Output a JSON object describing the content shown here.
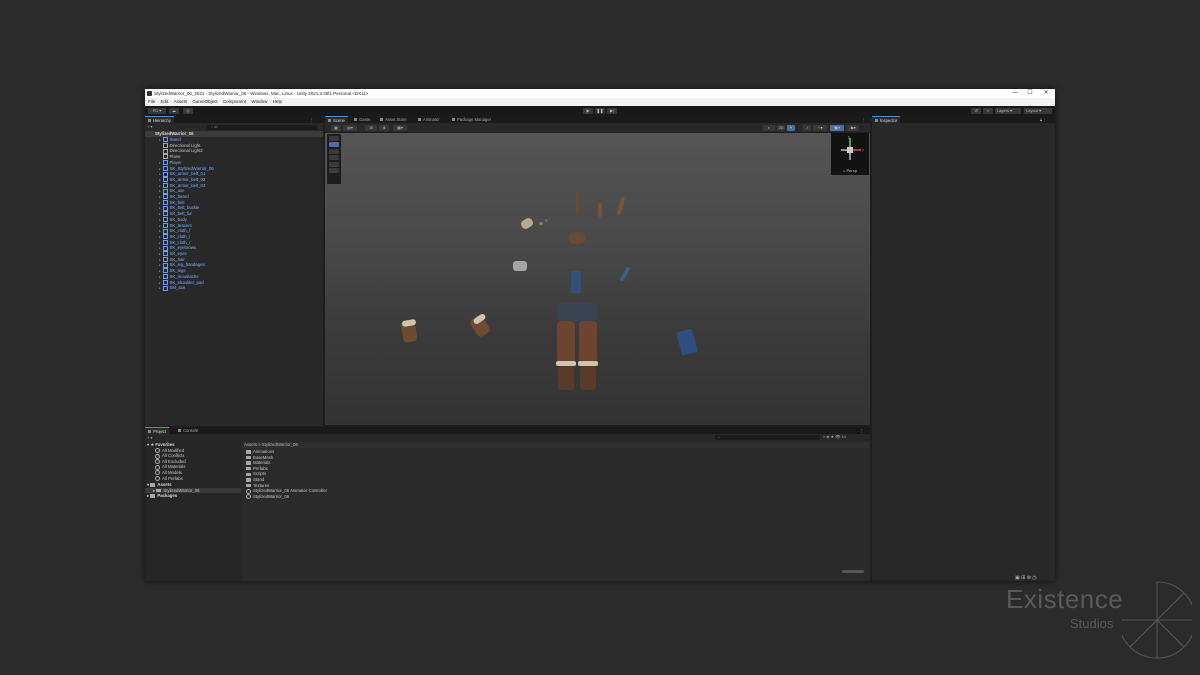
{
  "window": {
    "title": "StylizedWarrior_06_2021 - StylizedWarrior_06 - Windows, Mac, Linux - Unity 2021.3.25f1 Personal <DX11>",
    "controls": [
      "—",
      "☐",
      "✕"
    ]
  },
  "menu": [
    "File",
    "Edit",
    "Assets",
    "GameObject",
    "Component",
    "Window",
    "Help"
  ],
  "toolbar": {
    "account": "FD ▾",
    "layers": "Layers",
    "layout": "Layout"
  },
  "hierarchy": {
    "tab": "Hierarchy",
    "search_placeholder": "All",
    "root": "StylizedWarrior_06",
    "items": [
      {
        "label": "Stand",
        "plain": false
      },
      {
        "label": "Directional Light",
        "plain": true
      },
      {
        "label": "Directional Light2",
        "plain": true
      },
      {
        "label": "Plane",
        "plain": true
      },
      {
        "label": "Player",
        "plain": false
      },
      {
        "label": "SK_StylizedWarrior_06",
        "plain": false
      },
      {
        "label": "SK_armor_belt_01",
        "plain": false
      },
      {
        "label": "SK_armor_belt_02",
        "plain": false
      },
      {
        "label": "SK_armor_belt_03",
        "plain": false
      },
      {
        "label": "SK_axe",
        "plain": false
      },
      {
        "label": "SK_beard",
        "plain": false
      },
      {
        "label": "SK_belt",
        "plain": false
      },
      {
        "label": "SK_belt_buckle",
        "plain": false
      },
      {
        "label": "SK_belt_fur",
        "plain": false
      },
      {
        "label": "SK_body",
        "plain": false
      },
      {
        "label": "SK_bracers",
        "plain": false
      },
      {
        "label": "SK_cloth_f",
        "plain": false
      },
      {
        "label": "SK_cloth_l",
        "plain": false
      },
      {
        "label": "SK_cloth_r",
        "plain": false
      },
      {
        "label": "SK_eyebrows",
        "plain": false
      },
      {
        "label": "SK_eyes",
        "plain": false
      },
      {
        "label": "SK_hair",
        "plain": false
      },
      {
        "label": "SK_leg_bandages",
        "plain": false
      },
      {
        "label": "SK_legs",
        "plain": false
      },
      {
        "label": "SK_moustache",
        "plain": false
      },
      {
        "label": "SK_shoulder_pad",
        "plain": false
      },
      {
        "label": "SM_axe",
        "plain": false
      }
    ]
  },
  "scene_tabs": [
    "Scene",
    "Game",
    "Asset Store",
    "Animator",
    "Package Manager"
  ],
  "gizmo_label": "< Persp",
  "inspector": {
    "tab": "Inspector"
  },
  "project": {
    "tabs": [
      "Project",
      "Console"
    ],
    "favorites_label": "Favorites",
    "favorites": [
      "All Modified",
      "All Conflicts",
      "All Excluded",
      "All Materials",
      "All Models",
      "All Prefabs"
    ],
    "assets_label": "Assets",
    "assets_child": "StylizedWarrior_06",
    "packages_label": "Packages",
    "breadcrumb": "Assets > StylizedWarrior_06",
    "files": [
      {
        "label": "Animations",
        "kind": "folder"
      },
      {
        "label": "BaseMesh",
        "kind": "folder"
      },
      {
        "label": "Materials",
        "kind": "folder"
      },
      {
        "label": "Prefabs",
        "kind": "folder"
      },
      {
        "label": "Scripts",
        "kind": "folder"
      },
      {
        "label": "Stand",
        "kind": "folder"
      },
      {
        "label": "Textures",
        "kind": "folder"
      },
      {
        "label": "StylizedWarrior_06 Animator Controller",
        "kind": "asset"
      },
      {
        "label": "StylizedWarrior_06",
        "kind": "asset"
      }
    ],
    "count_badge": "14"
  },
  "watermark": {
    "line1": "Existence",
    "line2": "Studios"
  }
}
